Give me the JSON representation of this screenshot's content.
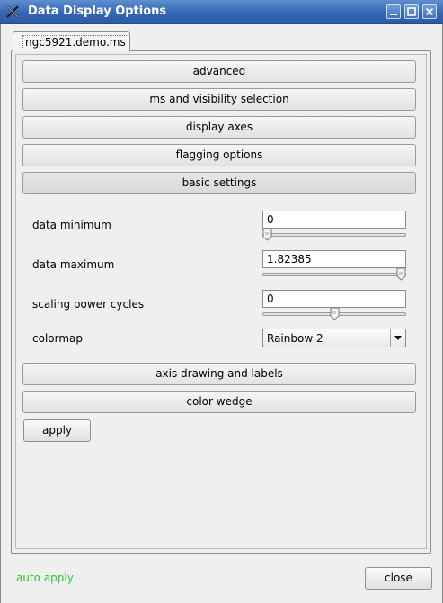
{
  "window": {
    "title": "Data Display Options"
  },
  "tabs": [
    {
      "label": "ngc5921.demo.ms"
    }
  ],
  "sections": {
    "advanced": "advanced",
    "ms_visibility": "ms and visibility selection",
    "display_axes": "display axes",
    "flagging": "flagging options",
    "basic_settings": "basic settings",
    "axis_drawing": "axis drawing and labels",
    "color_wedge": "color wedge"
  },
  "basic_settings": {
    "data_minimum": {
      "label": "data minimum",
      "value": "0",
      "slider_fraction": 0.0
    },
    "data_maximum": {
      "label": "data maximum",
      "value": "1.82385",
      "slider_fraction": 1.0
    },
    "scaling_power_cycles": {
      "label": "scaling power cycles",
      "value": "0",
      "slider_fraction": 0.5
    },
    "colormap": {
      "label": "colormap",
      "selected": "Rainbow 2"
    }
  },
  "buttons": {
    "apply": "apply",
    "close": "close"
  },
  "status": {
    "auto_apply": "auto apply",
    "auto_apply_color": "#2fc42f"
  },
  "icons": {
    "app": "x-window-icon",
    "minimize": "minimize-icon",
    "maximize": "maximize-icon",
    "close": "close-icon",
    "dropdown": "chevron-down-icon",
    "slider_thumb": "slider-thumb-icon"
  }
}
